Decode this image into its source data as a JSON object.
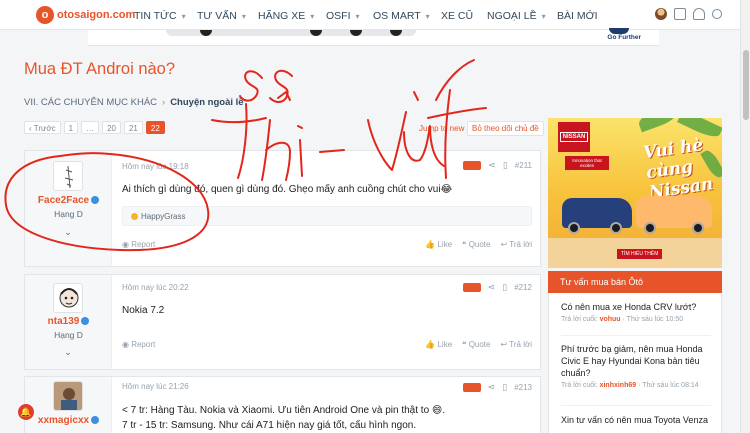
{
  "site": {
    "logo_text": "otosaigon.com",
    "logo_mark": "o"
  },
  "nav": {
    "items": [
      {
        "label": "TIN TỨC",
        "has_caret": true
      },
      {
        "label": "TƯ VẤN",
        "has_caret": true
      },
      {
        "label": "HÃNG XE",
        "has_caret": true
      },
      {
        "label": "OSFI",
        "has_caret": true
      },
      {
        "label": "OS MART",
        "has_caret": true
      },
      {
        "label": "XE CŨ",
        "has_caret": false
      },
      {
        "label": "NGOẠI LỀ",
        "has_caret": true
      },
      {
        "label": "BÀI MỚI",
        "has_caret": false
      }
    ],
    "icons": [
      "user-avatar",
      "mail-icon",
      "bell-icon",
      "search-icon"
    ]
  },
  "banner": {
    "brand_text": "Go Further"
  },
  "page": {
    "title": "Mua ĐT Androi nào?",
    "breadcrumb": {
      "parent": "VII. CÁC CHUYÊN MỤC KHÁC",
      "current": "Chuyện ngoài lề"
    },
    "pager": [
      "‹ Trước",
      "1",
      "…",
      "20",
      "21",
      "22"
    ],
    "pager_active": "22",
    "jump_label": "Jump to new",
    "follow_label": "Bỏ theo dõi chủ đề"
  },
  "posts": [
    {
      "username": "Face2Face",
      "rank": "Hạng D",
      "time": "Hôm nay lúc 19:18",
      "number": "#211",
      "text": "Ai thích gì dùng đó, quen gì dùng đó. Ghẹo mấy anh cuồng chút cho vui😂",
      "reaction": "HappyGrass",
      "report": "Report",
      "like": "Like",
      "quote": "Quote",
      "reply": "Trả lời"
    },
    {
      "username": "nta139",
      "rank": "Hạng D",
      "time": "Hôm nay lúc 20:22",
      "number": "#212",
      "text": "Nokia 7.2",
      "report": "Report",
      "like": "Like",
      "quote": "Quote",
      "reply": "Trả lời"
    },
    {
      "username": "xxmagicxx",
      "rank": "Hạng D",
      "time": "Hôm nay lúc 21:26",
      "number": "#213",
      "line1": "< 7 tr: Hàng Tàu. Nokia và Xiaomi. Ưu tiên Android One và pin thật to 😄.",
      "line2": "7 tr - 15 tr: Samsung. Như cái A71 hiện nay giá tốt, cấu hình ngon."
    }
  ],
  "ad": {
    "brand": "NISSAN",
    "tagline": "Innovation that excites",
    "headline": "Vui hè cùng Nissan",
    "cta": "TÌM HIỂU THÊM"
  },
  "sidebar_box": {
    "title": "Tư vấn mua bán Ôtô",
    "threads": [
      {
        "title": "Có nên mua xe Honda CRV lướt?",
        "meta_prefix": "Trả lời cuối:",
        "user": "vohuu",
        "when": "· Thứ sáu lúc 10:50"
      },
      {
        "title": "Phí trước bạ giảm, nên mua Honda Civic E hay Hyundai Kona bản tiêu chuẩn?",
        "meta_prefix": "Trả lời cuối:",
        "user": "xinhxinh69",
        "when": "· Thứ sáu lúc 08:14"
      },
      {
        "title": "Xin tư vấn có nên mua Toyota Venza",
        "meta_prefix": "",
        "user": "",
        "when": ""
      }
    ]
  },
  "notif_count": "🔔",
  "colors": {
    "accent": "#e8542a",
    "handwriting": "#e3261c"
  }
}
